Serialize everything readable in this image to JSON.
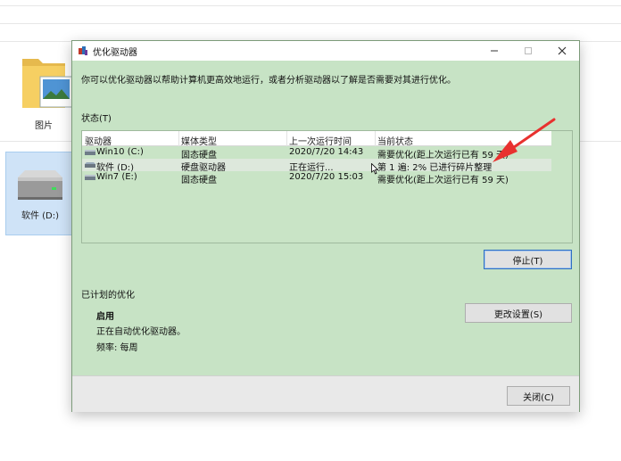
{
  "explorer": {
    "folder_label": "图片",
    "drive_label": "软件 (D:)"
  },
  "dialog": {
    "title": "优化驱动器",
    "description": "你可以优化驱动器以帮助计算机更高效地运行，或者分析驱动器以了解是否需要对其进行优化。",
    "status_label": "状态(T)",
    "columns": [
      "驱动器",
      "媒体类型",
      "上一次运行时间",
      "当前状态"
    ],
    "rows": [
      {
        "drive": "Win10 (C:)",
        "media": "固态硬盘",
        "last_run": "2020/7/20 14:43",
        "status": "需要优化(距上次运行已有 59 天)"
      },
      {
        "drive": "软件 (D:)",
        "media": "硬盘驱动器",
        "last_run": "正在运行...",
        "status": "第 1 遍: 2% 已进行碎片整理"
      },
      {
        "drive": "Win7 (E:)",
        "media": "固态硬盘",
        "last_run": "2020/7/20 15:03",
        "status": "需要优化(距上次运行已有 59 天)"
      }
    ],
    "stop_button": "停止(T)",
    "scheduled_label": "已计划的优化",
    "scheduled_state": "启用",
    "scheduled_desc": "正在自动优化驱动器。",
    "frequency": "频率: 每周",
    "change_settings_button": "更改设置(S)",
    "close_button": "关闭(C)"
  },
  "colors": {
    "dialog_bg": "#c7e3c5",
    "annotation_arrow": "#e8312f",
    "focus_border": "#2f6fc2"
  }
}
